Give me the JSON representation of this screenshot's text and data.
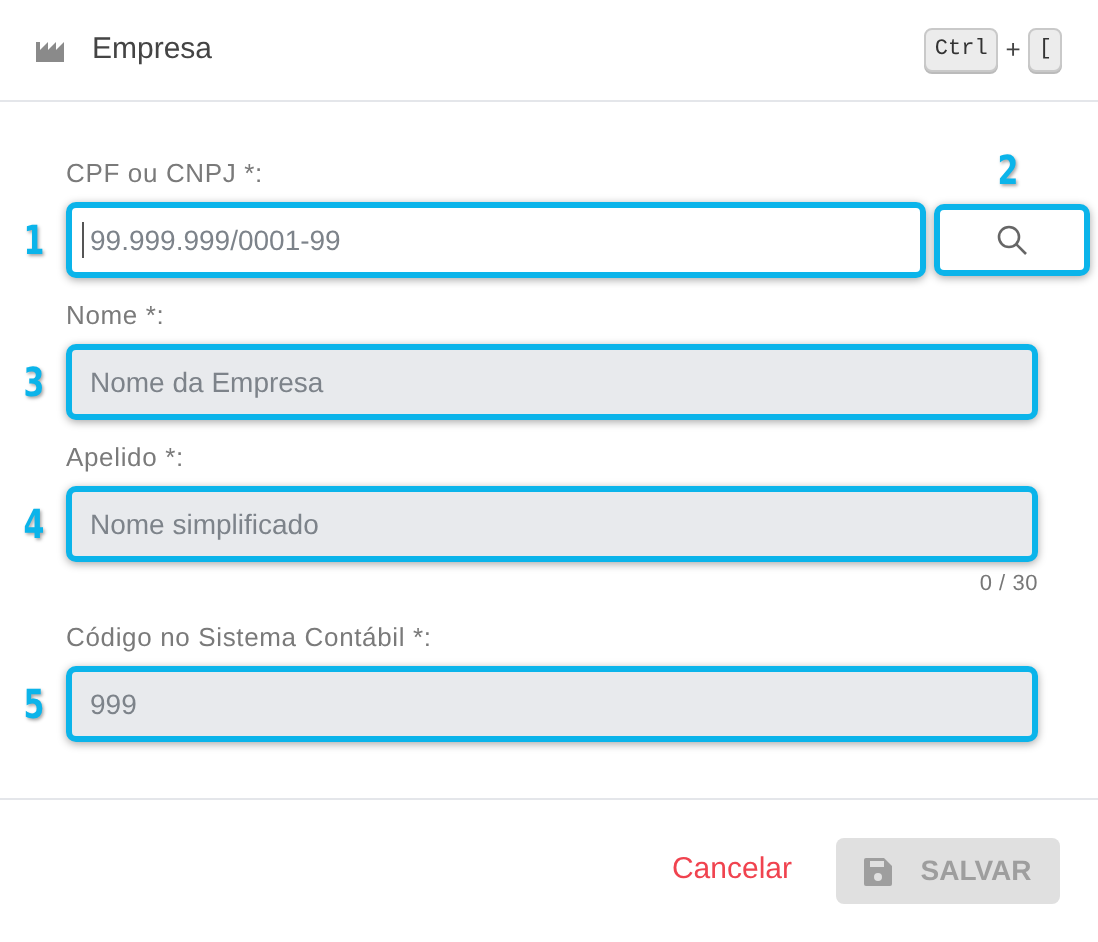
{
  "header": {
    "title": "Empresa",
    "shortcut": [
      {
        "kind": "key",
        "text": "Ctrl"
      },
      {
        "kind": "plus",
        "text": "+"
      },
      {
        "kind": "key",
        "text": "["
      }
    ]
  },
  "fields": [
    {
      "label": "CPF ou CNPJ *:",
      "placeholder": "99.999.999/0001-99",
      "disabled": false,
      "highlighted": true,
      "marker": "1",
      "focused": true,
      "search_button": {
        "marker": "2",
        "highlighted": true
      }
    },
    {
      "label": "Nome *:",
      "placeholder": "Nome da Empresa",
      "disabled": true,
      "highlighted": true,
      "marker": "3",
      "focused": false
    },
    {
      "label": "Apelido *:",
      "placeholder": "Nome simplificado",
      "disabled": true,
      "highlighted": true,
      "marker": "4",
      "focused": false,
      "counter": "0 / 30"
    },
    {
      "label": "Código no Sistema Contábil *:",
      "placeholder": "999",
      "disabled": true,
      "highlighted": true,
      "marker": "5",
      "focused": false
    }
  ],
  "footer": {
    "cancel": "Cancelar",
    "save": {
      "label": "SALVAR",
      "disabled": true
    }
  }
}
